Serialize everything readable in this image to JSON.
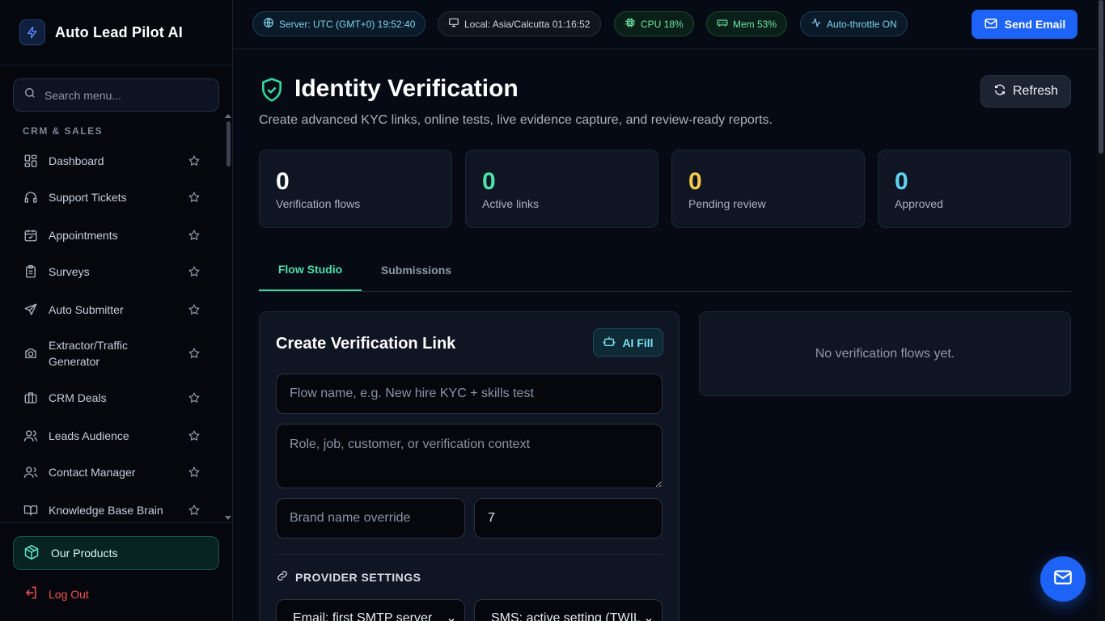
{
  "app": {
    "title": "Auto Lead Pilot AI"
  },
  "sidebar": {
    "search_placeholder": "Search menu...",
    "section": "CRM & SALES",
    "items": [
      {
        "label": "Dashboard",
        "icon": "grid-icon"
      },
      {
        "label": "Support Tickets",
        "icon": "headset-icon"
      },
      {
        "label": "Appointments",
        "icon": "calendar-check-icon"
      },
      {
        "label": "Surveys",
        "icon": "clipboard-icon"
      },
      {
        "label": "Auto Submitter",
        "icon": "send-icon"
      },
      {
        "label": "Extractor/Traffic Generator",
        "icon": "camera-icon"
      },
      {
        "label": "CRM Deals",
        "icon": "briefcase-icon"
      },
      {
        "label": "Leads Audience",
        "icon": "users-icon"
      },
      {
        "label": "Contact Manager",
        "icon": "user-group-icon"
      },
      {
        "label": "Knowledge Base Brain",
        "icon": "book-icon"
      }
    ],
    "products_label": "Our Products",
    "logout_label": "Log Out"
  },
  "topbar": {
    "server": "Server: UTC (GMT+0) 19:52:40",
    "local": "Local: Asia/Calcutta 01:16:52",
    "cpu": "CPU 18%",
    "mem": "Mem 53%",
    "throttle": "Auto-throttle ON",
    "send_label": "Send Email"
  },
  "page": {
    "title": "Identity Verification",
    "subtitle": "Create advanced KYC links, online tests, live evidence capture, and review-ready reports.",
    "refresh_label": "Refresh"
  },
  "stats": [
    {
      "value": "0",
      "label": "Verification flows",
      "color": "#ffffff"
    },
    {
      "value": "0",
      "label": "Active links",
      "color": "#4ee1a8"
    },
    {
      "value": "0",
      "label": "Pending review",
      "color": "#f5c84b"
    },
    {
      "value": "0",
      "label": "Approved",
      "color": "#5fd4f2"
    }
  ],
  "tabs": [
    {
      "label": "Flow Studio",
      "active": true
    },
    {
      "label": "Submissions",
      "active": false
    }
  ],
  "create_card": {
    "title": "Create Verification Link",
    "ai_fill_label": "AI Fill",
    "flow_name_placeholder": "Flow name, e.g. New hire KYC + skills test",
    "context_placeholder": "Role, job, customer, or verification context",
    "brand_placeholder": "Brand name override",
    "days_value": "7",
    "provider_title": "PROVIDER SETTINGS",
    "email_select": "Email: first SMTP server",
    "sms_select": "SMS: active setting (TWIL"
  },
  "flows_panel": {
    "empty_text": "No verification flows yet."
  },
  "colors": {
    "accent": "#1d63f5",
    "success": "#4ee1a8",
    "warning": "#f5c84b",
    "info": "#5fd4f2"
  }
}
